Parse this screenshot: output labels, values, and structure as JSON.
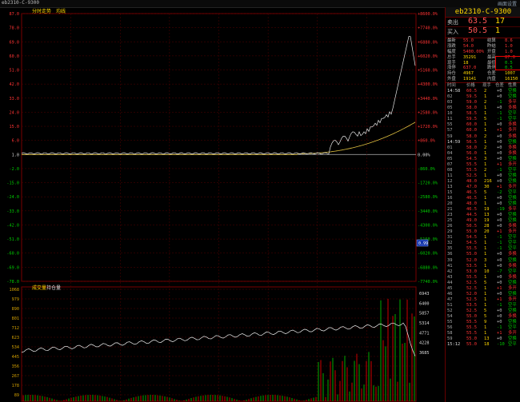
{
  "titlebar": {
    "title": "eb2310-C-9300",
    "right": "画面设置"
  },
  "chart": {
    "tabs": [
      "分时走势",
      "均线"
    ],
    "volume_tabs": [
      "成交量",
      "持仓量"
    ],
    "left_axis": [
      "87.0",
      "78.0",
      "69.0",
      "60.0",
      "51.0",
      "42.0",
      "33.0",
      "24.0",
      "15.0",
      "6.0",
      "-2.0",
      "-15.0",
      "-24.0",
      "-33.0",
      "-42.0",
      "-51.0",
      "-60.0",
      "-69.0",
      "-78.0"
    ],
    "right_axis": [
      "+8600.0%",
      "+7740.0%",
      "+6880.0%",
      "+6020.0%",
      "+5160.0%",
      "+4300.0%",
      "+3440.0%",
      "+2580.0%",
      "+1720.0%",
      "+860.0%",
      "0.00%",
      "-860.0%",
      "-1720.0%",
      "-2580.0%",
      "-3440.0%",
      "-4300.0%",
      "-5160.0%",
      "-6020.0%",
      "-6880.0%",
      "-7740.0%"
    ],
    "zero_label": "1.0",
    "vol_left_axis": [
      "1068",
      "979",
      "890",
      "801",
      "712",
      "623",
      "534",
      "445",
      "356",
      "267",
      "178",
      "89"
    ],
    "vol_right_axis": [
      "6943",
      "6400",
      "5857",
      "5314",
      "4771",
      "4228",
      "3685"
    ],
    "cursor_label": "0.99"
  },
  "quote_panel": {
    "contract": "eb2310-C-9300",
    "ask": {
      "label": "卖出",
      "price": "63.5",
      "vol": "17"
    },
    "bid": {
      "label": "买入",
      "price": "50.5",
      "vol": "1"
    },
    "stats": [
      {
        "l1": "最新",
        "v1": "55.0",
        "l2": "结算",
        "v2": "8.6"
      },
      {
        "l1": "涨跌",
        "v1": "54.0",
        "l2": "昨结",
        "v2": "1.0"
      },
      {
        "l1": "幅度",
        "v1": "5400.00%",
        "l2": "开盘",
        "v2": "1.0"
      },
      {
        "l1": "总手",
        "v1": "35291",
        "l2": "最高",
        "v2": "87.0"
      },
      {
        "l1": "现手",
        "v1": "18",
        "l2": "最低",
        "v2": "0.5"
      },
      {
        "l1": "涨停",
        "v1": "637.0",
        "l2": "跌停",
        "v2": "0.5"
      },
      {
        "l1": "持仓",
        "v1": "4967",
        "l2": "仓差",
        "v2": "1007"
      },
      {
        "l1": "外盘",
        "v1": "19141",
        "l2": "内盘",
        "v2": "16150"
      }
    ],
    "tick_header": {
      "time": "时间",
      "price": "价格",
      "vol": "现手",
      "oi": "仓差",
      "type": "性质"
    },
    "ticks": [
      {
        "t": "14:58",
        "p": "60.5",
        "v": "2",
        "o": "+0",
        "n": "空换"
      },
      {
        "t": "02",
        "p": "59.5",
        "v": "1",
        "o": "+0",
        "n": "空换"
      },
      {
        "t": "03",
        "p": "59.0",
        "v": "2",
        "o": "-1",
        "n": "多平"
      },
      {
        "t": "05",
        "p": "58.0",
        "v": "1",
        "o": "+0",
        "n": "多换"
      },
      {
        "t": "10",
        "p": "58.5",
        "v": "1",
        "o": "-1",
        "n": "空平"
      },
      {
        "t": "11",
        "p": "59.5",
        "v": "5",
        "o": "-1",
        "n": "空平"
      },
      {
        "t": "55",
        "p": "60.0",
        "v": "1",
        "o": "+0",
        "n": "多换"
      },
      {
        "t": "57",
        "p": "60.0",
        "v": "1",
        "o": "+1",
        "n": "多开"
      },
      {
        "t": "59",
        "p": "58.0",
        "v": "2",
        "o": "+0",
        "n": "多换"
      },
      {
        "t": "14:59",
        "p": "56.5",
        "v": "1",
        "o": "+0",
        "n": "空换"
      },
      {
        "t": "01",
        "p": "58.0",
        "v": "2",
        "o": "+0",
        "n": "多换"
      },
      {
        "t": "04",
        "p": "56.0",
        "v": "1",
        "o": "+0",
        "n": "多换"
      },
      {
        "t": "05",
        "p": "54.5",
        "v": "3",
        "o": "+0",
        "n": "空换"
      },
      {
        "t": "07",
        "p": "55.5",
        "v": "1",
        "o": "+1",
        "n": "多开"
      },
      {
        "t": "08",
        "p": "55.5",
        "v": "2",
        "o": "-1",
        "n": "空平"
      },
      {
        "t": "11",
        "p": "52.5",
        "v": "1",
        "o": "+0",
        "n": "空换"
      },
      {
        "t": "12",
        "p": "48.0",
        "v": "216",
        "o": "+0",
        "n": "空换"
      },
      {
        "t": "13",
        "p": "47.0",
        "v": "30",
        "o": "+1",
        "n": "多开"
      },
      {
        "t": "15",
        "p": "46.5",
        "v": "5",
        "o": "-2",
        "n": "空平"
      },
      {
        "t": "16",
        "p": "46.5",
        "v": "1",
        "o": "+0",
        "n": "空换"
      },
      {
        "t": "20",
        "p": "48.0",
        "v": "1",
        "o": "+0",
        "n": "空换"
      },
      {
        "t": "21",
        "p": "46.5",
        "v": "19",
        "o": "-19",
        "n": "多平"
      },
      {
        "t": "23",
        "p": "44.5",
        "v": "13",
        "o": "+0",
        "n": "空换"
      },
      {
        "t": "25",
        "p": "49.0",
        "v": "19",
        "o": "+0",
        "n": "空换"
      },
      {
        "t": "26",
        "p": "50.5",
        "v": "28",
        "o": "+0",
        "n": "多换"
      },
      {
        "t": "29",
        "p": "55.0",
        "v": "20",
        "o": "+1",
        "n": "多开"
      },
      {
        "t": "31",
        "p": "54.5",
        "v": "1",
        "o": "-1",
        "n": "空平"
      },
      {
        "t": "32",
        "p": "54.5",
        "v": "1",
        "o": "-1",
        "n": "空平"
      },
      {
        "t": "35",
        "p": "55.5",
        "v": "1",
        "o": "-1",
        "n": "空平"
      },
      {
        "t": "36",
        "p": "55.0",
        "v": "1",
        "o": "+0",
        "n": "多换"
      },
      {
        "t": "39",
        "p": "52.0",
        "v": "3",
        "o": "+0",
        "n": "空换"
      },
      {
        "t": "41",
        "p": "53.5",
        "v": "1",
        "o": "+0",
        "n": "多换"
      },
      {
        "t": "42",
        "p": "53.0",
        "v": "10",
        "o": "-7",
        "n": "空平"
      },
      {
        "t": "43",
        "p": "55.5",
        "v": "1",
        "o": "+0",
        "n": "多换"
      },
      {
        "t": "44",
        "p": "52.5",
        "v": "5",
        "o": "+0",
        "n": "空换"
      },
      {
        "t": "45",
        "p": "52.5",
        "v": "1",
        "o": "+1",
        "n": "多开"
      },
      {
        "t": "46",
        "p": "52.0",
        "v": "1",
        "o": "+0",
        "n": "空换"
      },
      {
        "t": "47",
        "p": "52.5",
        "v": "1",
        "o": "+1",
        "n": "多开"
      },
      {
        "t": "51",
        "p": "53.5",
        "v": "1",
        "o": "-1",
        "n": "空平"
      },
      {
        "t": "52",
        "p": "52.5",
        "v": "5",
        "o": "+0",
        "n": "空换"
      },
      {
        "t": "54",
        "p": "55.0",
        "v": "5",
        "o": "+0",
        "n": "多换"
      },
      {
        "t": "55",
        "p": "55.5",
        "v": "9",
        "o": "+0",
        "n": "空换"
      },
      {
        "t": "56",
        "p": "55.5",
        "v": "1",
        "o": "-1",
        "n": "空平"
      },
      {
        "t": "58",
        "p": "55.5",
        "v": "1",
        "o": "+1",
        "n": "多开"
      },
      {
        "t": "59",
        "p": "55.0",
        "v": "13",
        "o": "+0",
        "n": "空换"
      },
      {
        "t": "15:12",
        "p": "55.0",
        "v": "18",
        "o": "-10",
        "n": "空平"
      }
    ]
  },
  "colors": {
    "up": "#ff3333",
    "down": "#00cc00",
    "price_line": "#e6e6e6",
    "avg_line": "#e0c040",
    "grid": "#550000"
  }
}
